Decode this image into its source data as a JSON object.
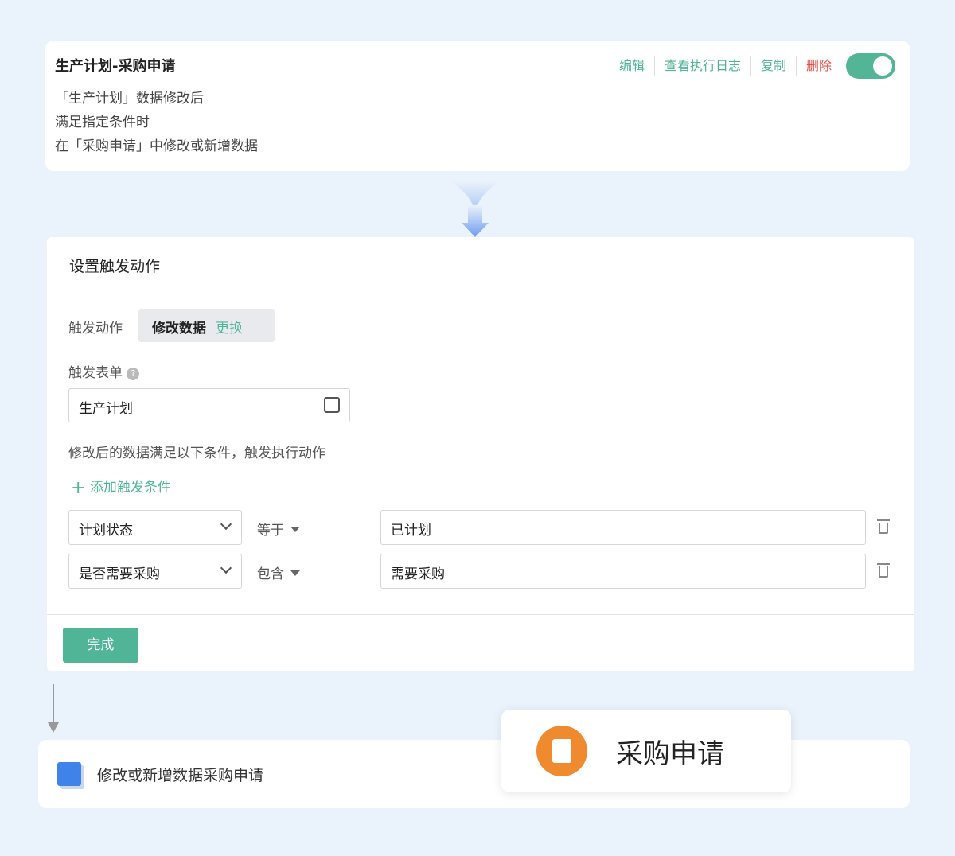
{
  "rule": {
    "title": "生产计划-采购申请",
    "lines": [
      "「生产计划」数据修改后",
      "满足指定条件时",
      "在「采购申请」中修改或新增数据"
    ],
    "actions": {
      "edit": "编辑",
      "log": "查看执行日志",
      "copy": "复制",
      "delete": "删除"
    },
    "enabled": true
  },
  "panel": {
    "title": "设置触发动作",
    "action_label": "触发动作",
    "action_value": "修改数据",
    "action_change": "更换",
    "form_label": "触发表单",
    "form_value": "生产计划",
    "cond_desc": "修改后的数据满足以下条件，触发执行动作",
    "add_cond": "添加触发条件",
    "conditions": [
      {
        "field": "计划状态",
        "op": "等于",
        "value": "已计划"
      },
      {
        "field": "是否需要采购",
        "op": "包含",
        "value": "需要采购"
      }
    ],
    "done": "完成"
  },
  "step": {
    "label": "修改或新增数据采购申请"
  },
  "popup": {
    "label": "采购申请"
  }
}
